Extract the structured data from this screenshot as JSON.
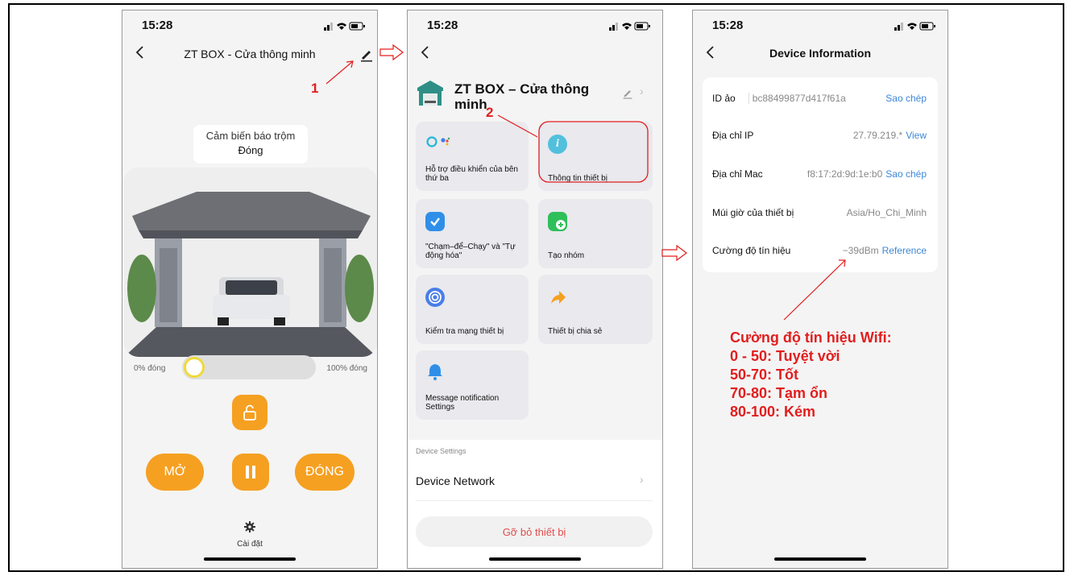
{
  "phones": {
    "control": {
      "status_time": "15:28",
      "title": "ZT BOX - Cửa thông minh",
      "sensor_label": "Cảm biến báo trộm",
      "sensor_value": "Đóng",
      "slider_min_label": "0% đóng",
      "slider_max_label": "100% đóng",
      "open_label": "MỞ",
      "close_label": "ĐÓNG",
      "settings_label": "Cài đặt"
    },
    "settings": {
      "status_time": "15:28",
      "device_title": "ZT BOX – Cửa thông minh",
      "tiles": [
        {
          "label": "Hỗ trợ điều khiển của bên thứ ba"
        },
        {
          "label": "Thông tin thiết bị"
        },
        {
          "label": "\"Chạm–để–Chạy\" và \"Tự động hóa\""
        },
        {
          "label": "Tạo nhóm"
        },
        {
          "label": "Kiểm tra mạng thiết bị"
        },
        {
          "label": "Thiết bị chia sẻ"
        },
        {
          "label": "Message notification Settings"
        }
      ],
      "section_label": "Device Settings",
      "network_label": "Device Network",
      "remove_label": "Gỡ bỏ thiết bị"
    },
    "info": {
      "status_time": "15:28",
      "title": "Device Information",
      "rows": [
        {
          "key": "ID ảo",
          "value": "bc88499877d417f61a",
          "action": "Sao chép"
        },
        {
          "key": "Địa chỉ IP",
          "value": "27.79.219.*",
          "action": "View"
        },
        {
          "key": "Địa chỉ Mac",
          "value": "f8:17:2d:9d:1e:b0",
          "action": "Sao chép"
        },
        {
          "key": "Múi giờ của thiết bị",
          "value": "Asia/Ho_Chi_Minh",
          "action": ""
        },
        {
          "key": "Cường độ tín hiệu",
          "value": "−39dBm",
          "action": "Reference"
        }
      ]
    }
  },
  "annotations": {
    "step1": "1",
    "step2": "2",
    "wifi_note": [
      "Cường độ tín hiệu Wifi:",
      "0 - 50: Tuyệt vời",
      "50-70: Tốt",
      "70-80: Tạm ổn",
      "80-100: Kém"
    ]
  },
  "colors": {
    "accent_orange": "#f5a021",
    "annotation_red": "#e21e1e",
    "link_blue": "#3b87d8",
    "remove_red": "#e24c4c"
  }
}
